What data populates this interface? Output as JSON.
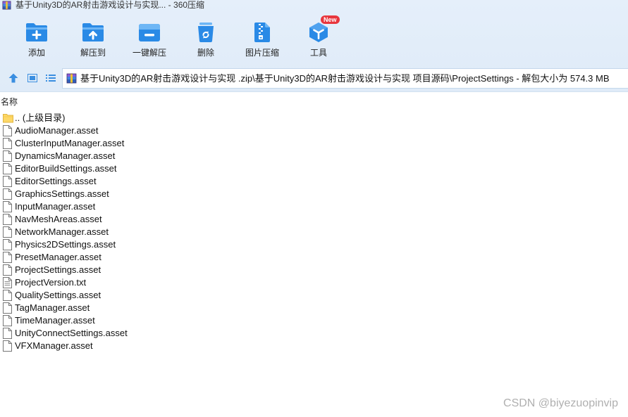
{
  "window": {
    "title": "基于Unity3D的AR射击游戏设计与实现... - 360压缩",
    "icon": "archive-app-icon"
  },
  "toolbar": {
    "buttons": [
      {
        "label": "添加",
        "icon": "add-folder-icon"
      },
      {
        "label": "解压到",
        "icon": "extract-to-folder-icon"
      },
      {
        "label": "一键解压",
        "icon": "one-click-extract-icon"
      },
      {
        "label": "删除",
        "icon": "recycle-bin-icon"
      },
      {
        "label": "图片压缩",
        "icon": "image-compress-icon"
      },
      {
        "label": "工具",
        "icon": "tools-cube-icon",
        "badge": "New"
      }
    ]
  },
  "navigation": {
    "icons": [
      "up-arrow-icon",
      "view-mode-icon",
      "list-view-icon"
    ]
  },
  "addressbar": {
    "icon": "archive-file-icon",
    "path": "基于Unity3D的AR射击游戏设计与实现 .zip\\基于Unity3D的AR射击游戏设计与实现 项目源码\\ProjectSettings - 解包大小为 574.3 MB"
  },
  "list": {
    "columns": [
      "名称"
    ],
    "items": [
      {
        "name": ".. (上级目录)",
        "icon": "folder-icon"
      },
      {
        "name": "AudioManager.asset",
        "icon": "file-icon"
      },
      {
        "name": "ClusterInputManager.asset",
        "icon": "file-icon"
      },
      {
        "name": "DynamicsManager.asset",
        "icon": "file-icon"
      },
      {
        "name": "EditorBuildSettings.asset",
        "icon": "file-icon"
      },
      {
        "name": "EditorSettings.asset",
        "icon": "file-icon"
      },
      {
        "name": "GraphicsSettings.asset",
        "icon": "file-icon"
      },
      {
        "name": "InputManager.asset",
        "icon": "file-icon"
      },
      {
        "name": "NavMeshAreas.asset",
        "icon": "file-icon"
      },
      {
        "name": "NetworkManager.asset",
        "icon": "file-icon"
      },
      {
        "name": "Physics2DSettings.asset",
        "icon": "file-icon"
      },
      {
        "name": "PresetManager.asset",
        "icon": "file-icon"
      },
      {
        "name": "ProjectSettings.asset",
        "icon": "file-icon"
      },
      {
        "name": "ProjectVersion.txt",
        "icon": "text-file-icon"
      },
      {
        "name": "QualitySettings.asset",
        "icon": "file-icon"
      },
      {
        "name": "TagManager.asset",
        "icon": "file-icon"
      },
      {
        "name": "TimeManager.asset",
        "icon": "file-icon"
      },
      {
        "name": "UnityConnectSettings.asset",
        "icon": "file-icon"
      },
      {
        "name": "VFXManager.asset",
        "icon": "file-icon"
      }
    ]
  },
  "watermark": "CSDN @biyezuopinvip",
  "colors": {
    "accent": "#2a8ae6",
    "accent_light": "#6db6f5",
    "badge": "#e8363d",
    "chrome_background": "#dfebf8",
    "folder": "#fdd867",
    "nav_icon": "#3a8ee0"
  }
}
